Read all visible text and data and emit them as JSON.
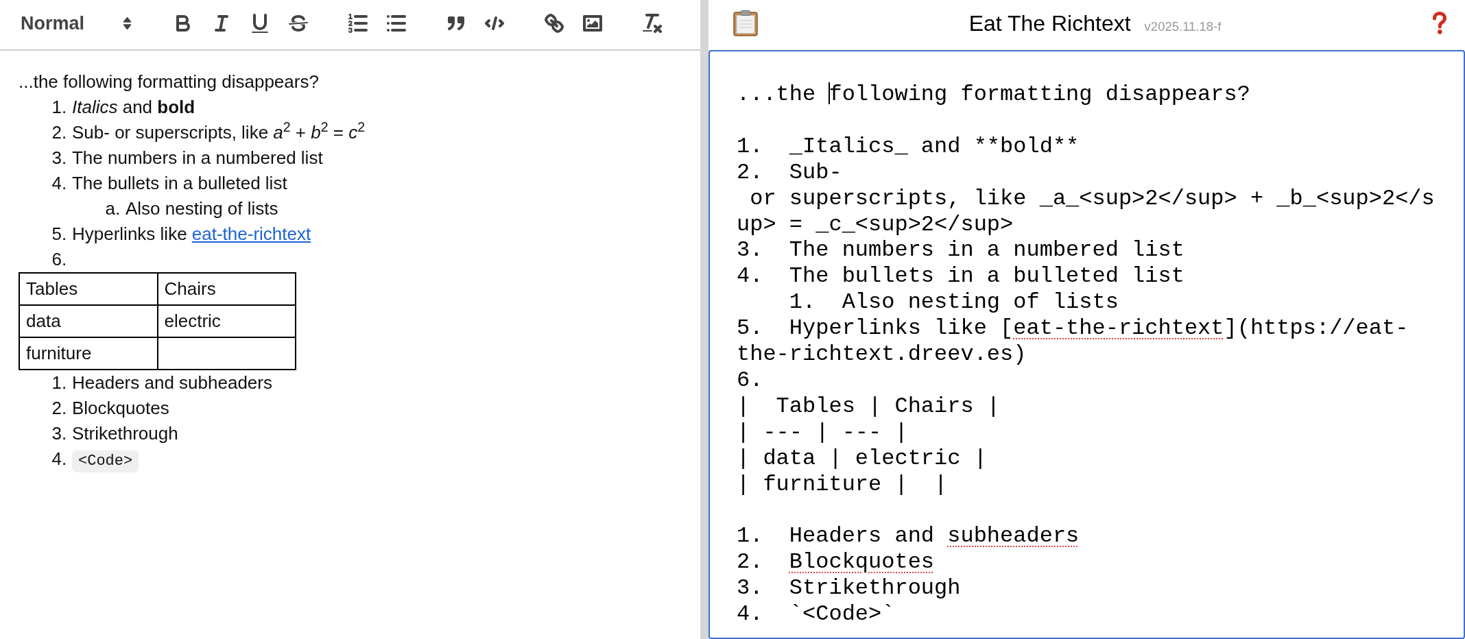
{
  "rich_editor": {
    "toolbar": {
      "format_select": "Normal"
    },
    "content": [
      {
        "kind": "paragraph",
        "text": "...the following formatting disappears?"
      },
      {
        "kind": "list",
        "items": [
          {
            "marker": "1.",
            "kind": "text",
            "text": "*Italics* and **bold**"
          },
          {
            "marker": "2.",
            "kind": "text",
            "text": "Sub- or superscripts, like *a*$^{2}$ + *b*$^{2}$ = *c*$^{2}$"
          },
          {
            "marker": "3.",
            "kind": "text",
            "text": "The numbers in a numbered list"
          },
          {
            "marker": "4.",
            "kind": "text",
            "text": "The bullets in a bulleted list",
            "children": [
              {
                "marker": "a.",
                "kind": "text",
                "text": "Also nesting of lists"
              }
            ]
          },
          {
            "marker": "5.",
            "kind": "link",
            "text": "Hyperlinks like ",
            "link": "eat-the-richtext"
          },
          {
            "marker": "6.",
            "kind": "empty"
          }
        ]
      },
      {
        "kind": "table",
        "columns": [
          "Tables",
          "Chairs"
        ],
        "rows": [
          [
            "data",
            "electric"
          ],
          [
            "furniture"
          ]
        ]
      },
      {
        "kind": "list",
        "items": [
          {
            "marker": "1.",
            "kind": "text",
            "text": "Headers and subheaders"
          },
          {
            "marker": "2.",
            "kind": "text",
            "text": "Blockquotes"
          },
          {
            "marker": "3.",
            "kind": "text",
            "text": "Strikethrough"
          },
          {
            "marker": "4.",
            "kind": "code",
            "text": "<Code>"
          }
        ]
      }
    ]
  },
  "app_header": {
    "title": "Eat The Richtext",
    "version": "v2025.11.18-f"
  },
  "markdown_editor": {
    "blocks": [
      {
        "lines": [
          {
            "spans": [
              {
                "kind": "text",
                "text": "...the "
              },
              {
                "kind": "cursor"
              },
              {
                "kind": "text",
                "text": "following formatting disappears?"
              }
            ]
          }
        ]
      },
      {
        "lines": [
          {
            "spans": [
              {
                "kind": "text",
                "text": "1.  _Italics_ and **bold**"
              }
            ]
          },
          {
            "spans": [
              {
                "kind": "text",
                "text": "2.  Sub-"
              }
            ]
          },
          {
            "spans": [
              {
                "kind": "text",
                "text": " or superscripts, like _a_<sup>2</sup> + _b_<sup>2</s"
              }
            ]
          },
          {
            "spans": [
              {
                "kind": "text",
                "text": "up> = _c_<sup>2</sup>"
              }
            ]
          },
          {
            "spans": [
              {
                "kind": "text",
                "text": "3.  The numbers in a numbered list"
              }
            ]
          },
          {
            "spans": [
              {
                "kind": "text",
                "text": "4.  The bullets in a bulleted list"
              }
            ]
          },
          {
            "spans": [
              {
                "kind": "text",
                "text": "    1.  Also nesting of lists"
              }
            ]
          },
          {
            "spans": [
              {
                "kind": "text",
                "text": "5.  Hyperlinks like ["
              },
              {
                "kind": "misspelled",
                "text": "eat-the-richtext"
              },
              {
                "kind": "text",
                "text": "](https://eat-"
              }
            ]
          },
          {
            "spans": [
              {
                "kind": "text",
                "text": "the-richtext.dreev.es)"
              }
            ]
          },
          {
            "spans": [
              {
                "kind": "text",
                "text": "6."
              }
            ]
          },
          {
            "spans": [
              {
                "kind": "text",
                "text": "|  Tables | Chairs |"
              }
            ]
          },
          {
            "spans": [
              {
                "kind": "text",
                "text": "| --- | --- |"
              }
            ]
          },
          {
            "spans": [
              {
                "kind": "text",
                "text": "| data | electric |"
              }
            ]
          },
          {
            "spans": [
              {
                "kind": "text",
                "text": "| furniture |  |"
              }
            ]
          }
        ]
      },
      {
        "lines": [
          {
            "spans": [
              {
                "kind": "text",
                "text": "1.  Headers and "
              },
              {
                "kind": "misspelled",
                "text": "subheaders"
              }
            ]
          },
          {
            "spans": [
              {
                "kind": "text",
                "text": "2.  "
              },
              {
                "kind": "misspelled",
                "text": "Blockquotes"
              }
            ]
          },
          {
            "spans": [
              {
                "kind": "text",
                "text": "3.  Strikethrough"
              }
            ]
          },
          {
            "spans": [
              {
                "kind": "text",
                "text": "4.  `<Code>`"
              }
            ]
          }
        ]
      }
    ]
  }
}
